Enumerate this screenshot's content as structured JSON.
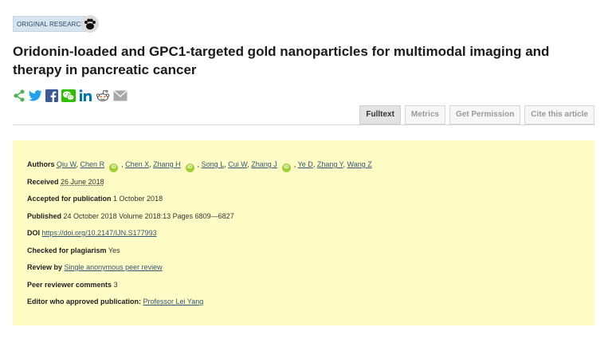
{
  "badge": {
    "label": "ORIGINAL RESEARCH",
    "icon": "open-access-icon"
  },
  "article": {
    "title": "Oridonin-loaded and GPC1-targeted gold nanoparticles for multimodal imaging and therapy in pancreatic cancer"
  },
  "share": {
    "icons": [
      "share-icon",
      "twitter-icon",
      "facebook-icon",
      "wechat-icon",
      "linkedin-icon",
      "reddit-icon",
      "email-icon"
    ],
    "colors": {
      "share": "#4ab44a",
      "twitter": "#1da1f2",
      "facebook": "#3b5998",
      "wechat": "#2dc100",
      "linkedin": "#0077b5",
      "email": "#999999"
    }
  },
  "tabs": [
    {
      "label": "Fulltext",
      "active": true
    },
    {
      "label": "Metrics",
      "active": false
    },
    {
      "label": "Get Permission",
      "active": false
    },
    {
      "label": "Cite this article",
      "active": false
    }
  ],
  "details": {
    "authors_label": "Authors",
    "authors": [
      "Qiu W",
      "Chen R",
      "Chen X",
      "Zhang H",
      "Song L",
      "Cui W",
      "Zhang J",
      "Ye D",
      "Zhang Y",
      "Wang Z"
    ],
    "orcid_badge": "iD",
    "received_label": "Received",
    "received": "26 June 2018",
    "accepted_label": "Accepted for publication",
    "accepted": "1 October 2018",
    "published_label": "Published",
    "published": "24 October 2018 Volume 2018:13 Pages 6809—6827",
    "doi_label": "DOI",
    "doi": "https://doi.org/10.2147/IJN.S177993",
    "plagiarism_label": "Checked for plagiarism",
    "plagiarism": "Yes",
    "review_label": "Review by",
    "review": "Single anonymous peer review",
    "reviewer_comments_label": "Peer reviewer comments",
    "reviewer_comments": "3",
    "editor_label": "Editor who approved publication:",
    "editor": "Professor Lei Yang"
  },
  "colors": {
    "info_background": "#fffcc6",
    "badge_background": "#d6e4f0",
    "orcid": "#a6ce39"
  }
}
